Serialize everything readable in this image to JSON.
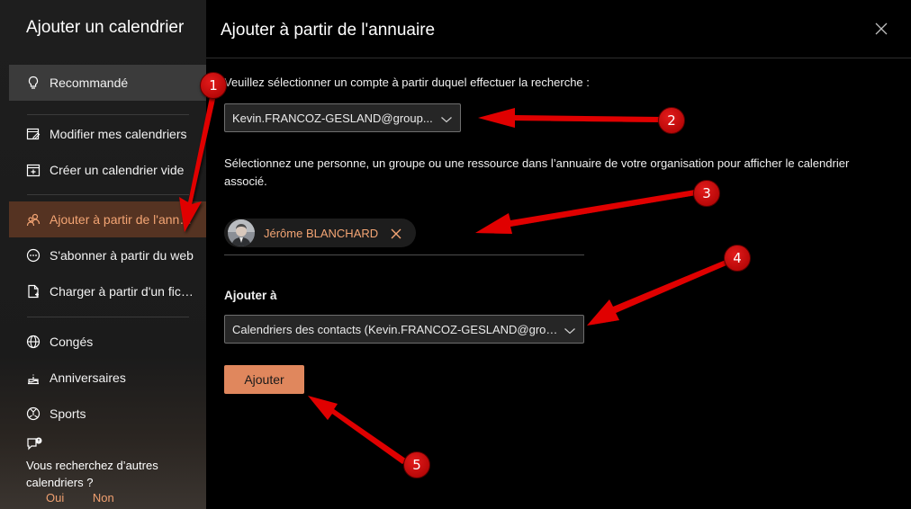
{
  "sidebar": {
    "title": "Ajouter un calendrier",
    "items": [
      {
        "label": "Recommandé",
        "icon": "lightbulb-icon"
      },
      {
        "label": "Modifier mes calendriers",
        "icon": "edit-calendar-icon"
      },
      {
        "label": "Créer un calendrier vide",
        "icon": "add-calendar-icon"
      },
      {
        "label": "Ajouter à partir de l'annuaire",
        "icon": "people-icon"
      },
      {
        "label": "S'abonner à partir du web",
        "icon": "web-icon"
      },
      {
        "label": "Charger à partir d'un fichier",
        "icon": "file-upload-icon"
      },
      {
        "label": "Congés",
        "icon": "globe-icon"
      },
      {
        "label": "Anniversaires",
        "icon": "cake-icon"
      },
      {
        "label": "Sports",
        "icon": "ball-icon"
      }
    ],
    "feedback": {
      "question": "Vous recherchez d’autres calendriers ?",
      "yes": "Oui",
      "no": "Non"
    }
  },
  "main": {
    "title": "Ajouter à partir de l'annuaire",
    "account_prompt": "Veuillez sélectionner un compte à partir duquel effectuer la recherche :",
    "account_value": "Kevin.FRANCOZ-GESLAND@group...",
    "search_prompt": "Sélectionnez une personne, un groupe ou une ressource dans l’annuaire de votre organisation pour afficher le calendrier associé.",
    "selected_person": "Jérôme BLANCHARD",
    "add_to_label": "Ajouter à",
    "add_to_value": "Calendriers des contacts (Kevin.FRANCOZ-GESLAND@grou...",
    "submit_label": "Ajouter"
  },
  "annotations": [
    "1",
    "2",
    "3",
    "4",
    "5"
  ],
  "colors": {
    "accent": "#e0875d",
    "accent_text": "#f4a574",
    "selected_bg": "#553322",
    "annotation_red": "#e00000"
  }
}
